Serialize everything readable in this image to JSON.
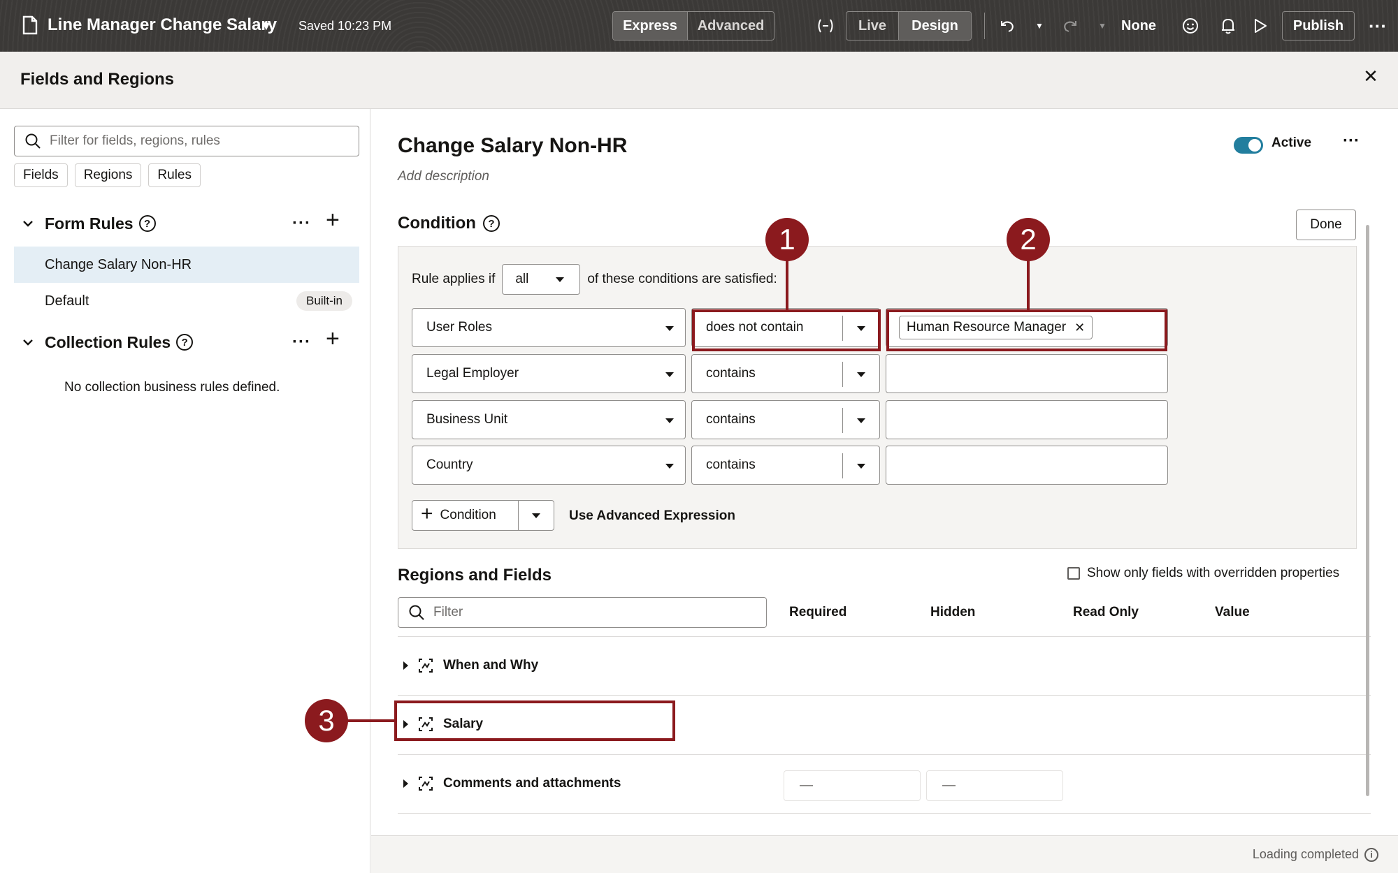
{
  "topbar": {
    "title": "Line Manager Change Salary",
    "saved": "Saved 10:23 PM",
    "mode_tabs": [
      "Express",
      "Advanced"
    ],
    "view_tabs": [
      "Live",
      "Design"
    ],
    "active_mode": "Express",
    "active_view": "Design",
    "none_label": "None",
    "publish_label": "Publish",
    "icons": [
      "document-icon",
      "title-dropdown-icon",
      "expression-icon",
      "undo-icon",
      "undo-dropdown-icon",
      "redo-icon",
      "redo-dropdown-icon",
      "feedback-smiley-icon",
      "notifications-bell-icon",
      "preview-play-icon",
      "more-icon"
    ]
  },
  "panel": {
    "title": "Fields and Regions",
    "close_icon": "close-icon"
  },
  "left": {
    "search_placeholder": "Filter for fields, regions, rules",
    "chips": [
      "Fields",
      "Regions",
      "Rules"
    ],
    "form_rules_label": "Form Rules",
    "form_rules": [
      {
        "label": "Change Salary Non-HR",
        "selected": true
      },
      {
        "label": "Default",
        "badge": "Built-in"
      }
    ],
    "collection_rules_label": "Collection Rules",
    "collection_empty": "No collection business rules defined."
  },
  "rule": {
    "title": "Change Salary Non-HR",
    "description_placeholder": "Add description",
    "active_label": "Active",
    "active": true
  },
  "condition": {
    "title": "Condition",
    "done_label": "Done",
    "applies_prefix": "Rule applies if",
    "applies_value": "all",
    "applies_suffix": "of these conditions are satisfied:",
    "rows": [
      {
        "field": "User Roles",
        "operator": "does not contain",
        "value_tag": "Human Resource Manager"
      },
      {
        "field": "Legal Employer",
        "operator": "contains",
        "value_tag": ""
      },
      {
        "field": "Business Unit",
        "operator": "contains",
        "value_tag": ""
      },
      {
        "field": "Country",
        "operator": "contains",
        "value_tag": ""
      }
    ],
    "add_label": "Condition",
    "advanced_label": "Use Advanced Expression"
  },
  "regions": {
    "title": "Regions and Fields",
    "show_only_label": "Show only fields with overridden properties",
    "filter_placeholder": "Filter",
    "columns": [
      "Required",
      "Hidden",
      "Read Only",
      "Value"
    ],
    "rows": [
      {
        "label": "When and Why"
      },
      {
        "label": "Salary"
      },
      {
        "label": "Comments and attachments",
        "required": "—",
        "hidden": "—"
      }
    ]
  },
  "status": {
    "text": "Loading completed"
  },
  "callouts": [
    "1",
    "2",
    "3"
  ],
  "colors": {
    "topbar": "#3b3937",
    "callout": "#8b1a1e",
    "toggle": "#227e9e",
    "selected_rule": "#e4eef5"
  }
}
